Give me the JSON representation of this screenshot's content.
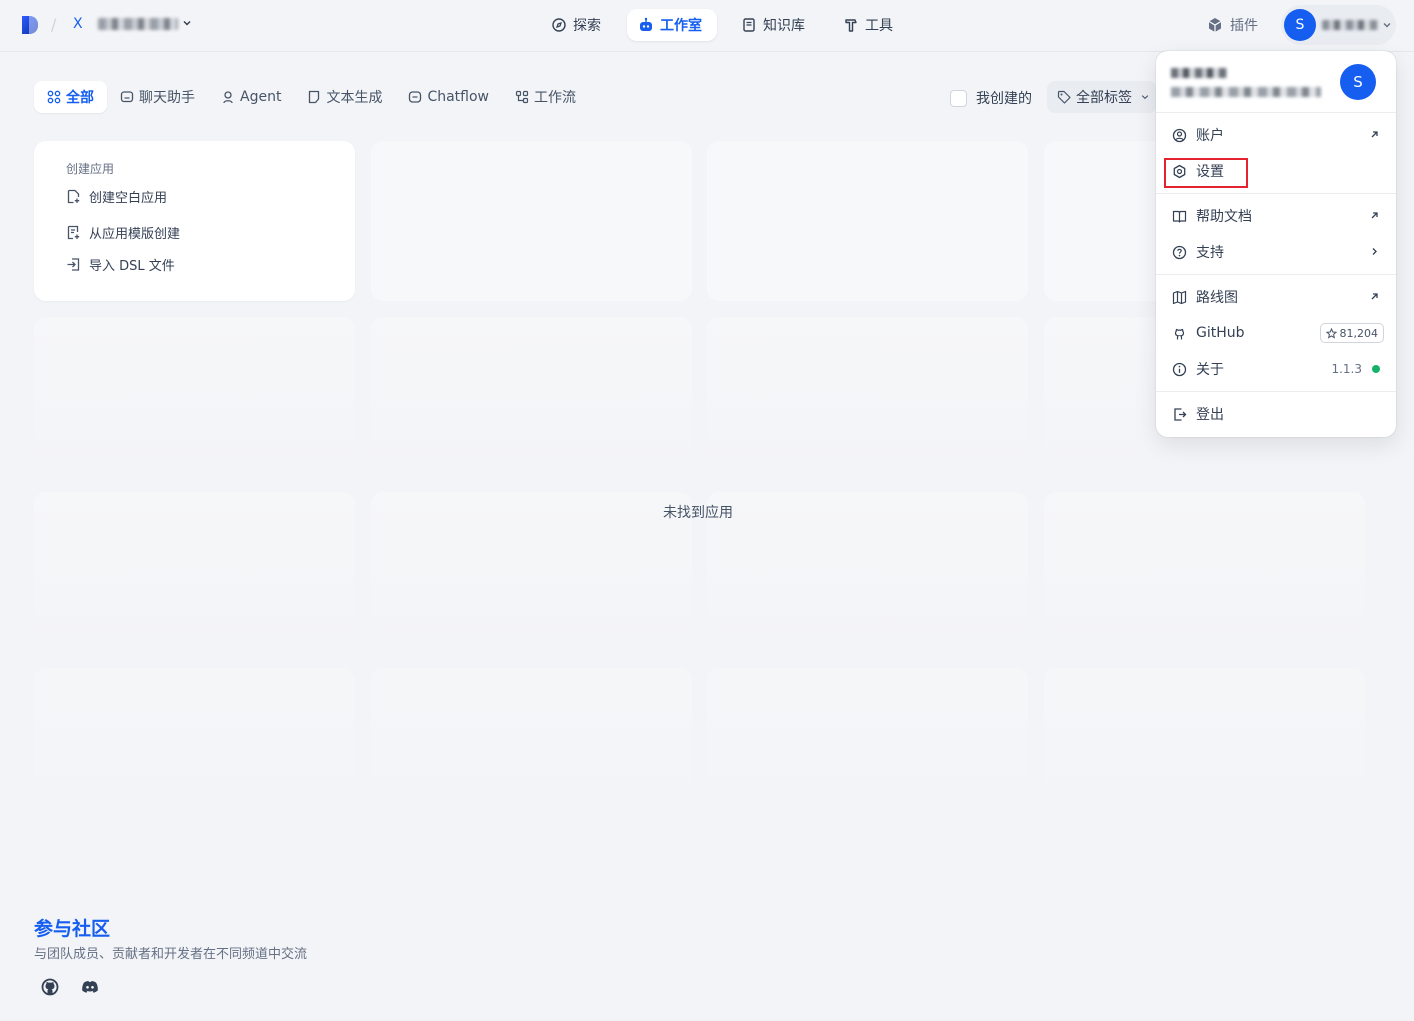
{
  "header": {
    "workspace_initial": "X",
    "nav": [
      {
        "label": "探索",
        "icon": "compass-icon",
        "active": false
      },
      {
        "label": "工作室",
        "icon": "robot-icon",
        "active": true
      },
      {
        "label": "知识库",
        "icon": "book-icon",
        "active": false
      },
      {
        "label": "工具",
        "icon": "hammer-icon",
        "active": false
      }
    ],
    "plugins_label": "插件",
    "user_initial": "S"
  },
  "filters": {
    "tabs": [
      {
        "label": "全部",
        "icon": "grid-icon",
        "active": true
      },
      {
        "label": "聊天助手",
        "icon": "chat-icon",
        "active": false
      },
      {
        "label": "Agent",
        "icon": "agent-icon",
        "active": false
      },
      {
        "label": "文本生成",
        "icon": "document-icon",
        "active": false
      },
      {
        "label": "Chatflow",
        "icon": "chatflow-icon",
        "active": false
      },
      {
        "label": "工作流",
        "icon": "workflow-icon",
        "active": false
      }
    ],
    "created_by_me_label": "我创建的",
    "all_tags_label": "全部标签"
  },
  "create_card": {
    "title": "创建应用",
    "items": [
      {
        "label": "创建空白应用",
        "icon": "file-plus-icon"
      },
      {
        "label": "从应用模版创建",
        "icon": "template-icon"
      },
      {
        "label": "导入 DSL 文件",
        "icon": "import-icon"
      }
    ]
  },
  "empty_state": "未找到应用",
  "community": {
    "title": "参与社区",
    "description": "与团队成员、贡献者和开发者在不同频道中交流"
  },
  "user_menu": {
    "avatar_initial": "S",
    "items": {
      "account": "账户",
      "settings": "设置",
      "help_docs": "帮助文档",
      "support": "支持",
      "roadmap": "路线图",
      "github": "GitHub",
      "github_stars": "81,204",
      "about": "关于",
      "version": "1.1.3",
      "logout": "登出"
    }
  },
  "colors": {
    "accent": "#155eef",
    "background": "#f2f4f7",
    "highlight": "#e5222d",
    "status_online": "#17b26a"
  }
}
